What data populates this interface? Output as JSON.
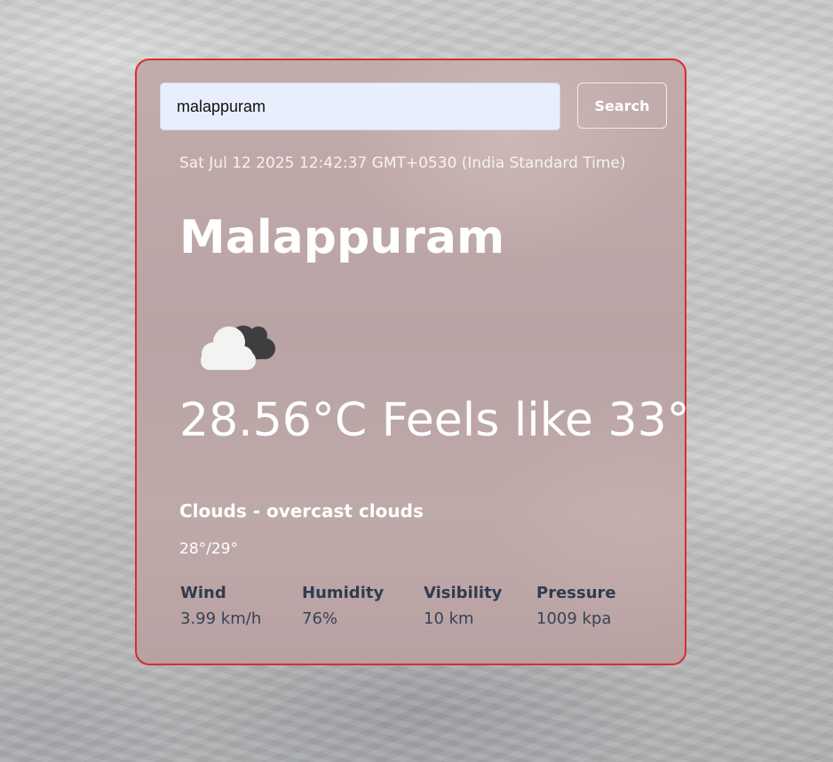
{
  "search": {
    "value": "malappuram",
    "button_label": "Search"
  },
  "datetime": "Sat Jul 12 2025 12:42:37 GMT+0530 (India Standard Time)",
  "city": "Malappuram",
  "weather_icon": "overcast-clouds-icon",
  "temperature": "28.56°C Feels like 33°",
  "condition": "Clouds - overcast clouds",
  "min_max": "28°/29°",
  "stats": {
    "wind": {
      "label": "Wind",
      "value": "3.99 km/h"
    },
    "humidity": {
      "label": "Humidity",
      "value": "76%"
    },
    "visibility": {
      "label": "Visibility",
      "value": "10 km"
    },
    "pressure": {
      "label": "Pressure",
      "value": "1009 kpa"
    }
  },
  "colors": {
    "card_border": "#dc2c2c",
    "input_background": "#e8eefc",
    "stat_text": "#313b4f"
  }
}
